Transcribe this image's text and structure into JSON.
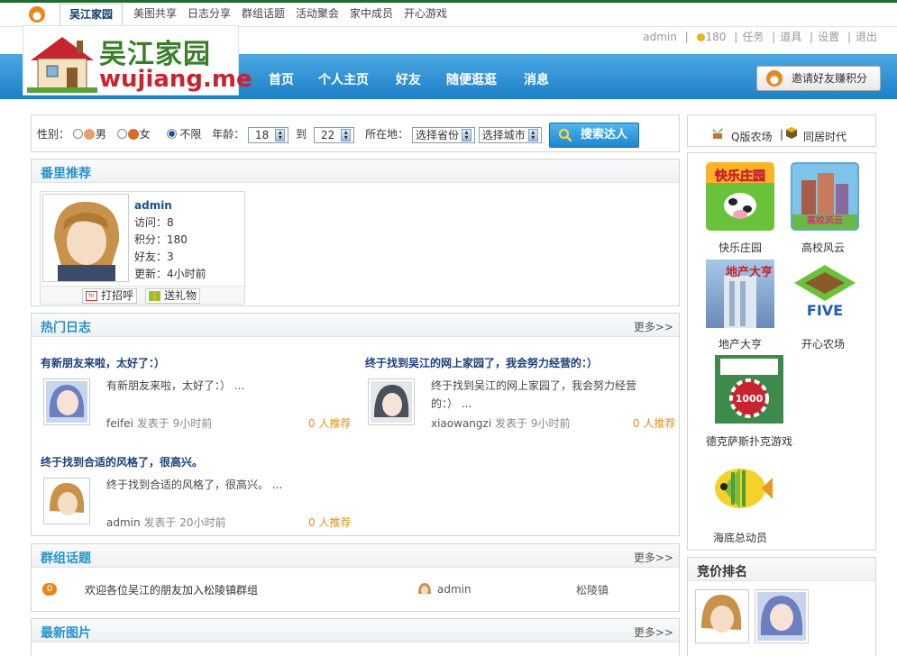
{
  "topnav": {
    "tabs": [
      "吴江家园",
      "美图共享",
      "日志分享",
      "群组话题",
      "活动聚会",
      "家中成员",
      "开心游戏"
    ]
  },
  "header": {
    "logo_cn": "吴江家园",
    "logo_en": "wujiang.me",
    "user": "admin",
    "coins": "180",
    "links": [
      "任务",
      "道具",
      "设置",
      "退出"
    ],
    "nav": [
      "首页",
      "个人主页",
      "好友",
      "随便逛逛",
      "消息"
    ],
    "invite": "邀请好友赚积分"
  },
  "search": {
    "gender_label": "性别：",
    "male": "男",
    "female": "女",
    "any": "不限",
    "age_label": "年龄：",
    "age_from": "18",
    "to": "到",
    "age_to": "22",
    "location_label": "所在地：",
    "province": "选择省份",
    "city": "选择城市",
    "button": "搜索达人"
  },
  "recommend": {
    "title": "番里推荐",
    "name": "admin",
    "visits": "访问：8",
    "points": "积分：180",
    "friends": "好友：3",
    "updated": "更新：4小时前",
    "greet": "打招呼",
    "gift": "送礼物"
  },
  "blogs": {
    "title": "热门日志",
    "more": "更多>>",
    "items": [
      {
        "title": "有新朋友来啦，太好了：）",
        "excerpt": "有新朋友来啦，太好了：） ...",
        "excerpt2": "",
        "author": "feifei",
        "posted": "发表于",
        "time": "9小时前",
        "rec": "0 人推荐"
      },
      {
        "title": "终于找到吴江的网上家园了，我会努力经营的：）",
        "excerpt": "终于找到吴江的网上家园了，我会努力经营",
        "excerpt2": "的：） ...",
        "author": "xiaowangzi",
        "posted": "发表于",
        "time": "9小时前",
        "rec": "0 人推荐"
      },
      {
        "title": "终于找到合适的风格了，很高兴。",
        "excerpt": "终于找到合适的风格了，很高兴。 ...",
        "excerpt2": "",
        "author": "admin",
        "posted": "发表于",
        "time": "20小时前",
        "rec": "0 人推荐"
      }
    ]
  },
  "groups": {
    "title": "群组话题",
    "more": "更多>>",
    "count": "0",
    "topic": "欢迎各位吴江的朋友加入松陵镇群组",
    "author": "admin",
    "group": "松陵镇"
  },
  "photos": {
    "title": "最新图片",
    "more": "更多>>"
  },
  "apps_top": {
    "farm": "Q版农场",
    "sep": "|",
    "neighbors": "同居时代"
  },
  "apps": [
    {
      "label": "快乐庄园",
      "img_text": "快乐庄园"
    },
    {
      "label": "高校风云",
      "img_text": "高校风云"
    },
    {
      "label": "地产大亨",
      "img_text": "地产大亨"
    },
    {
      "label": "开心农场",
      "img_text": "FIVE"
    },
    {
      "label": "德克萨斯扑克游戏",
      "img_text": "1000"
    },
    {
      "label": "海底总动员",
      "img_text": ""
    }
  ],
  "bid": {
    "title": "竞价排名"
  },
  "colors": {
    "brand_blue": "#1e7fc8",
    "title_blue": "#2993c7",
    "accent_orange": "#e28f1d"
  }
}
